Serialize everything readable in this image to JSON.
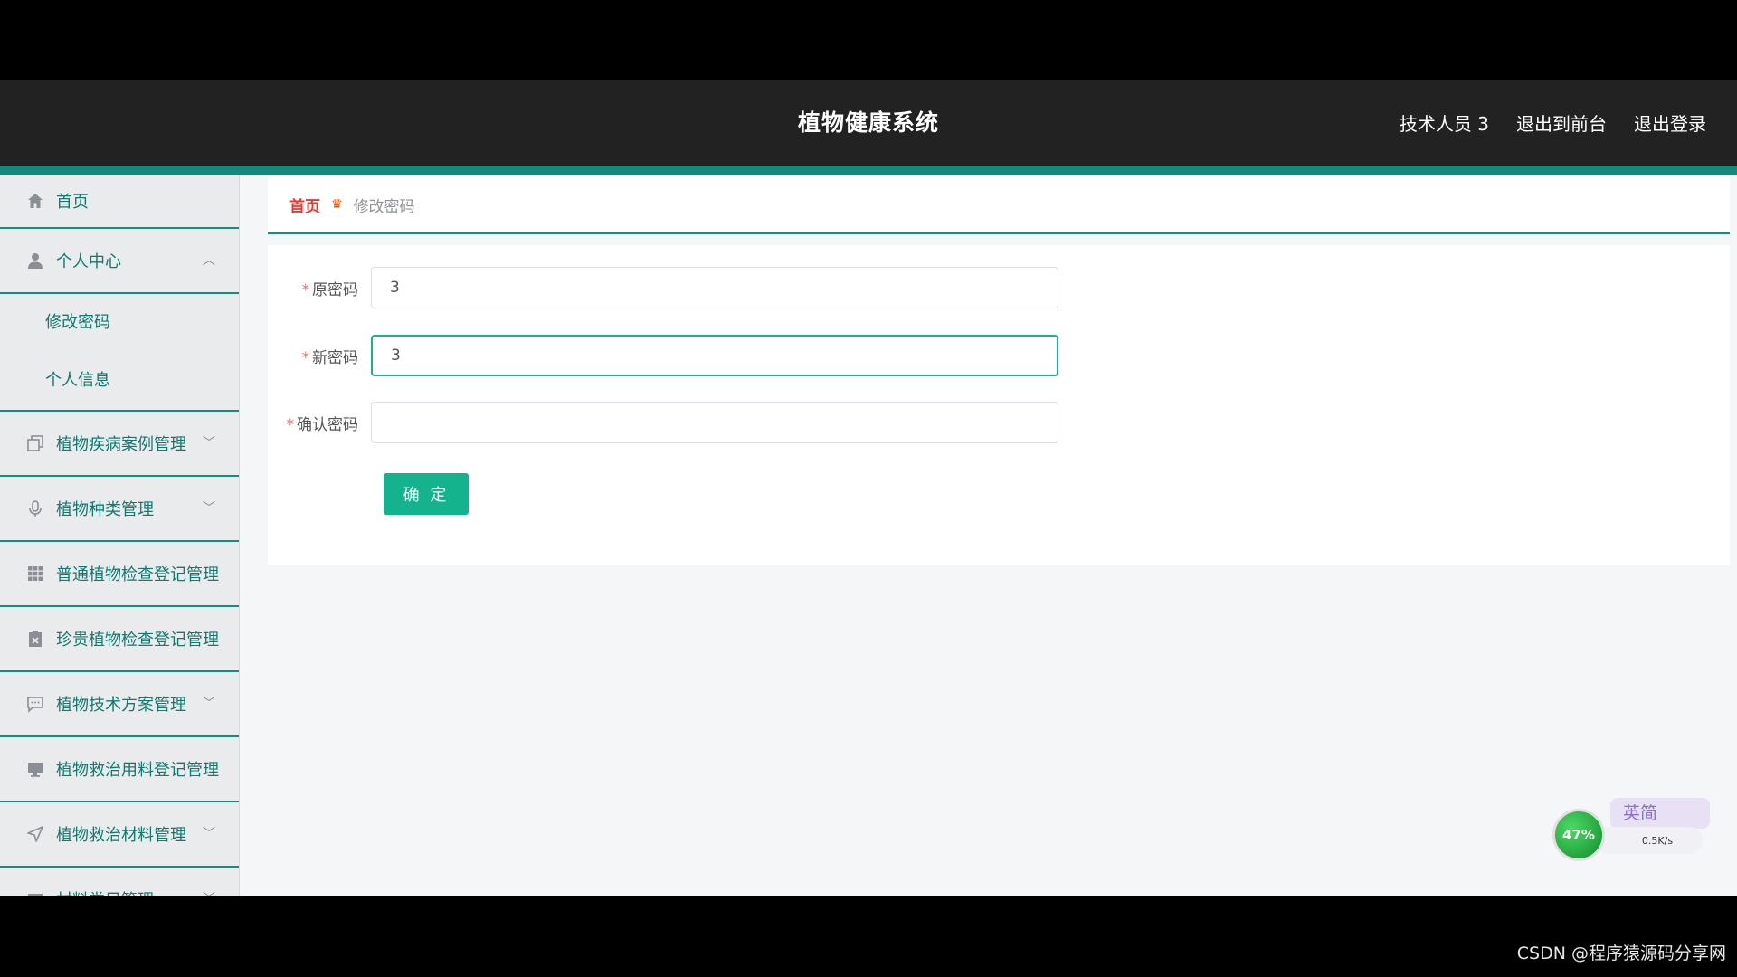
{
  "header": {
    "title": "植物健康系统",
    "user": "技术人员 3",
    "to_front": "退出到前台",
    "logout": "退出登录"
  },
  "sidebar": {
    "home": "首页",
    "personal_center": "个人中心",
    "personal_sub": [
      "修改密码",
      "个人信息"
    ],
    "items": [
      "植物疾病案例管理",
      "植物种类管理",
      "普通植物检查登记管理",
      "珍贵植物检查登记管理",
      "植物技术方案管理",
      "植物救治用料登记管理",
      "植物救治材料管理",
      "材料类目管理"
    ]
  },
  "breadcrumb": {
    "home": "首页",
    "current": "修改密码"
  },
  "form": {
    "old_password_label": "原密码",
    "old_password_value": "3",
    "new_password_label": "新密码",
    "new_password_value": "3",
    "confirm_password_label": "确认密码",
    "confirm_password_value": "",
    "submit_label": "确 定"
  },
  "widget": {
    "percent": "47%",
    "speed": "0.5K/s",
    "ime": "英简"
  },
  "watermark": "CSDN @程序猿源码分享网",
  "colors": {
    "accent": "#11897d",
    "button": "#14b38e",
    "header_bg": "#222222",
    "crumb_home": "#e53935"
  }
}
